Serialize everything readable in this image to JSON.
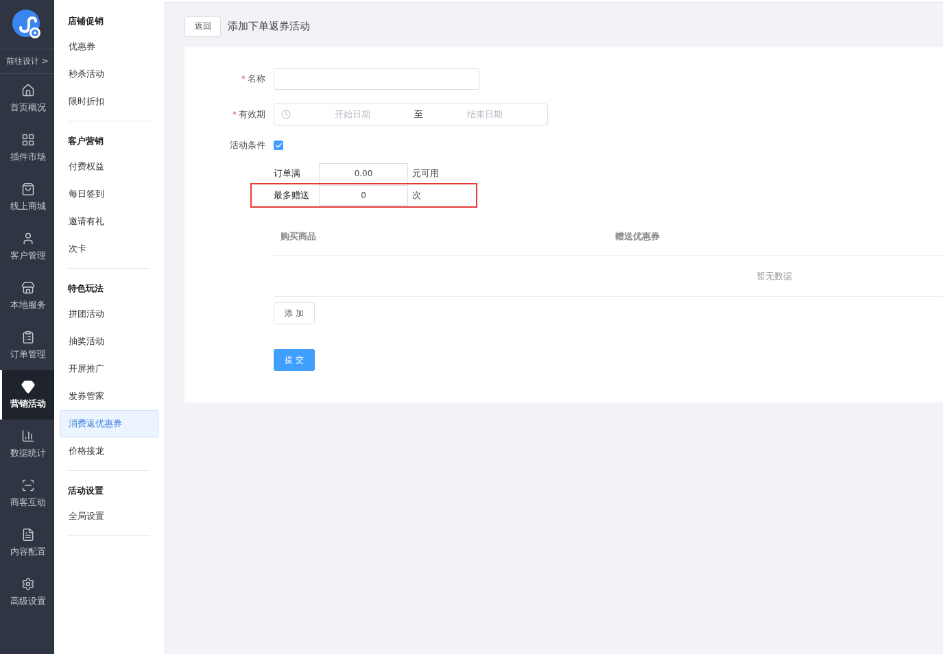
{
  "nav": {
    "design_link": "前往设计 >",
    "items": [
      {
        "label": "首页概况",
        "selected": false
      },
      {
        "label": "插件市场",
        "selected": false
      },
      {
        "label": "线上商城",
        "selected": false
      },
      {
        "label": "客户管理",
        "selected": false
      },
      {
        "label": "本地服务",
        "selected": false
      },
      {
        "label": "订单管理",
        "selected": false
      },
      {
        "label": "营销活动",
        "selected": true
      },
      {
        "label": "数据统计",
        "selected": false
      },
      {
        "label": "商客互动",
        "selected": false
      },
      {
        "label": "内容配置",
        "selected": false
      },
      {
        "label": "高级设置",
        "selected": false
      }
    ]
  },
  "submenu": [
    {
      "title": "店铺促销",
      "items": [
        {
          "label": "优惠券",
          "selected": false
        },
        {
          "label": "秒杀活动",
          "selected": false
        },
        {
          "label": "限时折扣",
          "selected": false
        }
      ]
    },
    {
      "title": "客户营销",
      "items": [
        {
          "label": "付费权益",
          "selected": false
        },
        {
          "label": "每日签到",
          "selected": false
        },
        {
          "label": "邀请有礼",
          "selected": false
        },
        {
          "label": "次卡",
          "selected": false
        }
      ]
    },
    {
      "title": "特色玩法",
      "items": [
        {
          "label": "拼团活动",
          "selected": false
        },
        {
          "label": "抽奖活动",
          "selected": false
        },
        {
          "label": "开屏推广",
          "selected": false
        },
        {
          "label": "发券管家",
          "selected": false
        },
        {
          "label": "消费返优惠券",
          "selected": true
        },
        {
          "label": "价格接龙",
          "selected": false
        }
      ]
    },
    {
      "title": "活动设置",
      "items": [
        {
          "label": "全局设置",
          "selected": false
        }
      ]
    }
  ],
  "header": {
    "back_button": "返回",
    "title": "添加下单返券活动"
  },
  "form": {
    "name": {
      "label": "名称",
      "required_mark": "*"
    },
    "validity": {
      "label": "有效期",
      "required_mark": "*",
      "start_placeholder": "开始日期",
      "separator": "至",
      "end_placeholder": "结束日期"
    },
    "condition": {
      "label": "活动条件",
      "checked": true
    },
    "condition_rows": [
      {
        "label": "订单满",
        "value": "0.00",
        "unit": "元可用",
        "highlighted": false
      },
      {
        "label": "最多赠送",
        "value": "0",
        "unit": "次",
        "highlighted": true
      }
    ],
    "table": {
      "columns": [
        "购买商品",
        "赠送优惠券"
      ],
      "empty_text": "暂无数据"
    },
    "add_button": "添 加",
    "submit_button": "提 交"
  }
}
